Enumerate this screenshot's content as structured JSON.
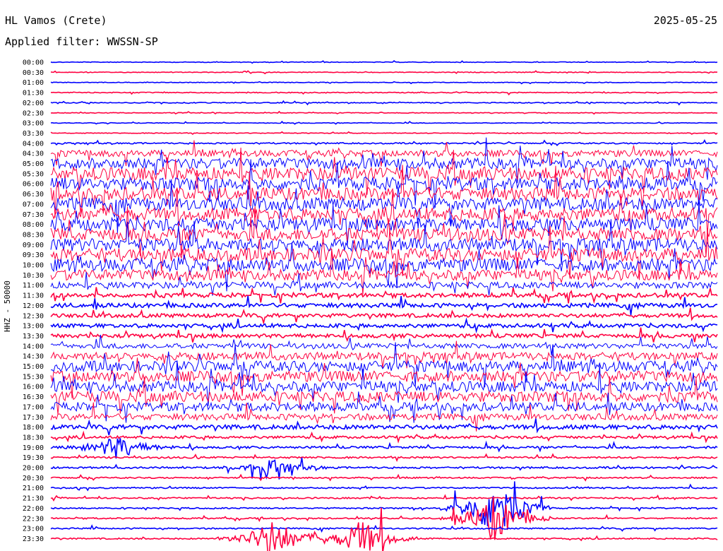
{
  "header": {
    "station": "HL Vamos (Crete)",
    "date": "2025-05-25",
    "filter": "Applied filter: WWSSN-SP"
  },
  "chart_data": {
    "type": "line",
    "title": "HL Vamos (Crete)",
    "ylabel": "HHZ - 50000",
    "rows": [
      "00:00",
      "00:30",
      "01:00",
      "01:30",
      "02:00",
      "02:30",
      "03:00",
      "03:30",
      "04:00",
      "04:30",
      "05:00",
      "05:30",
      "06:00",
      "06:30",
      "07:00",
      "07:30",
      "08:00",
      "08:30",
      "09:00",
      "09:30",
      "10:00",
      "10:30",
      "11:00",
      "11:30",
      "12:00",
      "12:30",
      "13:00",
      "13:30",
      "14:00",
      "14:30",
      "15:00",
      "15:30",
      "16:00",
      "16:30",
      "17:00",
      "17:30",
      "18:00",
      "18:30",
      "19:00",
      "19:30",
      "20:00",
      "20:30",
      "21:00",
      "21:30",
      "22:00",
      "22:30",
      "23:00",
      "23:30"
    ],
    "colors": [
      "#0000ff",
      "#ff0040"
    ],
    "row_minutes": 30,
    "noise_level": [
      0.15,
      0.15,
      0.15,
      0.2,
      0.2,
      0.15,
      0.15,
      0.15,
      0.3,
      1.5,
      2.5,
      3,
      3,
      3,
      3,
      3,
      3,
      3,
      3,
      3,
      3,
      2.5,
      1.5,
      1,
      1,
      0.9,
      0.9,
      0.9,
      1.2,
      1.8,
      2.5,
      2.5,
      2.5,
      2.5,
      2,
      1.5,
      1,
      0.6,
      0.5,
      0.4,
      0.4,
      0.3,
      0.3,
      0.3,
      0.3,
      0.3,
      0.3,
      0.3
    ],
    "events": [
      {
        "row": 38,
        "minute": 3,
        "amplitude": 1.2
      },
      {
        "row": 40,
        "minute": 10,
        "amplitude": 0.8
      },
      {
        "row": 45,
        "minute": 20,
        "amplitude": 2.5
      },
      {
        "row": 44,
        "minute": 20,
        "amplitude": 3.5
      },
      {
        "row": 47,
        "minute": 10,
        "amplitude": 2.2
      },
      {
        "row": 47,
        "minute": 14,
        "amplitude": 2.0
      }
    ]
  }
}
